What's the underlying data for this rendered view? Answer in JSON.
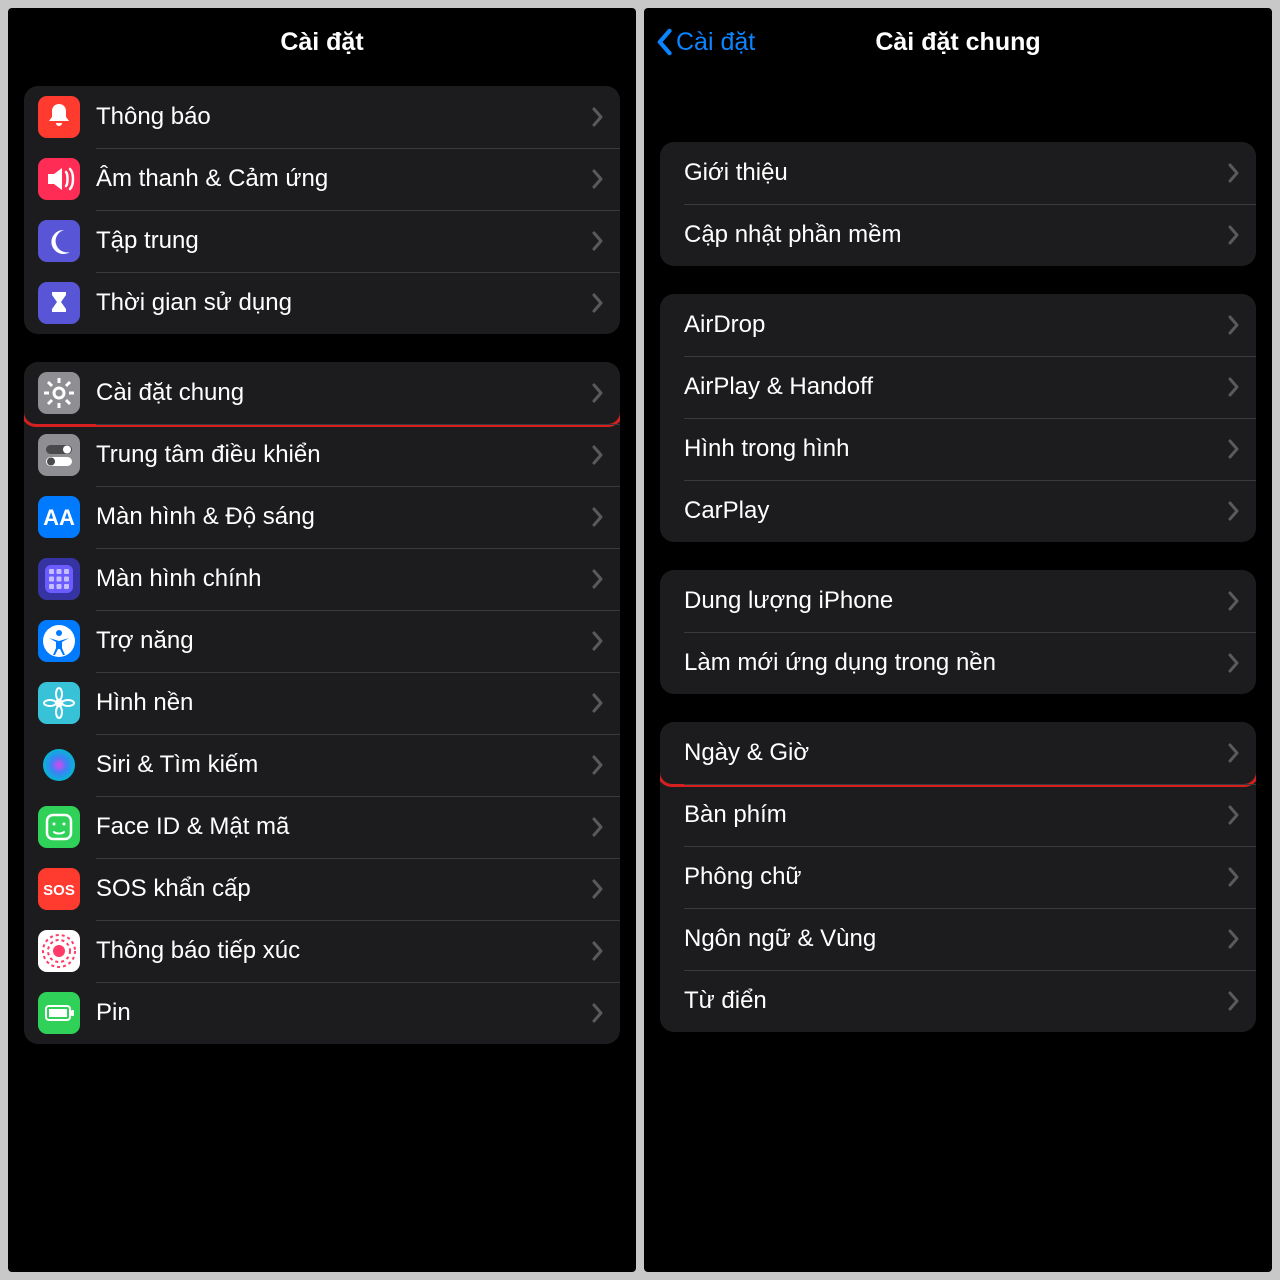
{
  "left": {
    "title": "Cài đặt",
    "groups": [
      {
        "rows": [
          {
            "id": "notifications",
            "label": "Thông báo",
            "icon": "bell-icon",
            "bg": "#ff3b30"
          },
          {
            "id": "sounds",
            "label": "Âm thanh & Cảm ứng",
            "icon": "speaker-icon",
            "bg": "#ff2d55"
          },
          {
            "id": "focus",
            "label": "Tập trung",
            "icon": "moon-icon",
            "bg": "#5856d6"
          },
          {
            "id": "screentime",
            "label": "Thời gian sử dụng",
            "icon": "hourglass-icon",
            "bg": "#5856d6"
          }
        ]
      },
      {
        "rows": [
          {
            "id": "general",
            "label": "Cài đặt chung",
            "icon": "gear-icon",
            "bg": "#8e8e93",
            "highlight": true
          },
          {
            "id": "control-center",
            "label": "Trung tâm điều khiển",
            "icon": "switches-icon",
            "bg": "#8e8e93"
          },
          {
            "id": "display",
            "label": "Màn hình & Độ sáng",
            "icon": "aa-icon",
            "bg": "#007aff"
          },
          {
            "id": "homescreen",
            "label": "Màn hình chính",
            "icon": "grid-icon",
            "bg": "#3634a3"
          },
          {
            "id": "accessibility",
            "label": "Trợ năng",
            "icon": "accessibility-icon",
            "bg": "#007aff"
          },
          {
            "id": "wallpaper",
            "label": "Hình nền",
            "icon": "flower-icon",
            "bg": "#37c2d8"
          },
          {
            "id": "siri",
            "label": "Siri & Tìm kiếm",
            "icon": "siri-icon",
            "bg": "#1c1c1e",
            "special": "siri"
          },
          {
            "id": "faceid",
            "label": "Face ID & Mật mã",
            "icon": "face-icon",
            "bg": "#30d158"
          },
          {
            "id": "sos",
            "label": "SOS khẩn cấp",
            "icon": "sos-icon",
            "bg": "#ff3b30"
          },
          {
            "id": "exposure",
            "label": "Thông báo tiếp xúc",
            "icon": "exposure-icon",
            "bg": "#ffffff",
            "special": "exposure"
          },
          {
            "id": "battery",
            "label": "Pin",
            "icon": "battery-icon",
            "bg": "#30d158"
          }
        ]
      }
    ]
  },
  "right": {
    "back": "Cài đặt",
    "title": "Cài đặt chung",
    "groups": [
      {
        "rows": [
          {
            "id": "about",
            "label": "Giới thiệu"
          },
          {
            "id": "update",
            "label": "Cập nhật phần mềm"
          }
        ]
      },
      {
        "rows": [
          {
            "id": "airdrop",
            "label": "AirDrop"
          },
          {
            "id": "airplay",
            "label": "AirPlay & Handoff"
          },
          {
            "id": "pip",
            "label": "Hình trong hình"
          },
          {
            "id": "carplay",
            "label": "CarPlay"
          }
        ]
      },
      {
        "rows": [
          {
            "id": "storage",
            "label": "Dung lượng iPhone"
          },
          {
            "id": "refresh",
            "label": "Làm mới ứng dụng trong nền"
          }
        ]
      },
      {
        "rows": [
          {
            "id": "datetime",
            "label": "Ngày & Giờ",
            "highlight": true
          },
          {
            "id": "keyboard",
            "label": "Bàn phím"
          },
          {
            "id": "fonts",
            "label": "Phông chữ"
          },
          {
            "id": "language",
            "label": "Ngôn ngữ & Vùng"
          },
          {
            "id": "dictionary",
            "label": "Từ điển"
          }
        ]
      }
    ]
  }
}
